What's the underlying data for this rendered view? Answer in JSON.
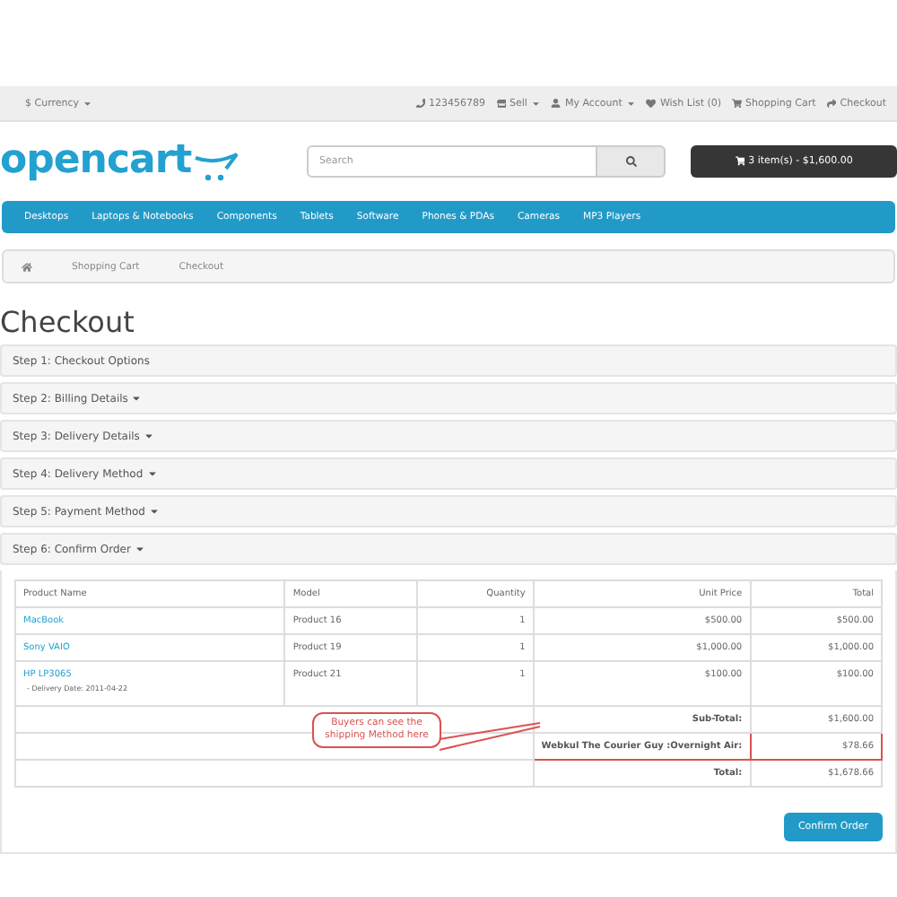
{
  "top_bar": {
    "currency": "$ Currency",
    "links": [
      {
        "kind": "phone",
        "label": "123456789",
        "caret": false
      },
      {
        "kind": "sell",
        "label": "Sell",
        "caret": true
      },
      {
        "kind": "account",
        "label": "My Account",
        "caret": true
      },
      {
        "kind": "heart",
        "label": "Wish List (0)",
        "caret": false
      },
      {
        "kind": "cart",
        "label": "Shopping Cart",
        "caret": false
      },
      {
        "kind": "share",
        "label": "Checkout",
        "caret": false
      }
    ]
  },
  "header": {
    "logo": "opencart",
    "search": {
      "placeholder": "Search"
    },
    "cart_button": "3 item(s) - $1,600.00"
  },
  "nav": [
    "Desktops",
    "Laptops & Notebooks",
    "Components",
    "Tablets",
    "Software",
    "Phones & PDAs",
    "Cameras",
    "MP3 Players"
  ],
  "breadcrumb": [
    "Shopping Cart",
    "Checkout"
  ],
  "title": "Checkout",
  "steps": [
    {
      "label": "Step 1: Checkout Options",
      "caret": false
    },
    {
      "label": "Step 2: Billing Details",
      "caret": true
    },
    {
      "label": "Step 3: Delivery Details",
      "caret": true
    },
    {
      "label": "Step 4: Delivery Method",
      "caret": true
    },
    {
      "label": "Step 5: Payment Method",
      "caret": true
    },
    {
      "label": "Step 6: Confirm Order",
      "caret": true
    }
  ],
  "table": {
    "columns": [
      "Product Name",
      "Model",
      "Quantity",
      "Unit Price",
      "Total"
    ],
    "rows": [
      {
        "name": "MacBook",
        "option": null,
        "model": "Product 16",
        "quantity": "1",
        "price": "$500.00",
        "total": "$500.00"
      },
      {
        "name": "Sony VAIO",
        "option": null,
        "model": "Product 19",
        "quantity": "1",
        "price": "$1,000.00",
        "total": "$1,000.00"
      },
      {
        "name": "HP LP3065",
        "option": "- Delivery Date: 2011-04-22",
        "model": "Product 21",
        "quantity": "1",
        "price": "$100.00",
        "total": "$100.00"
      }
    ],
    "totals": [
      {
        "label": "Sub-Total:",
        "value": "$1,600.00",
        "highlighted": false
      },
      {
        "label": "Webkul The Courier Guy :Overnight Air:",
        "value": "$78.66",
        "highlighted": true
      },
      {
        "label": "Total:",
        "value": "$1,678.66",
        "highlighted": false
      }
    ]
  },
  "callout": "Buyers can see the shipping Method here",
  "confirm_button": "Confirm Order"
}
